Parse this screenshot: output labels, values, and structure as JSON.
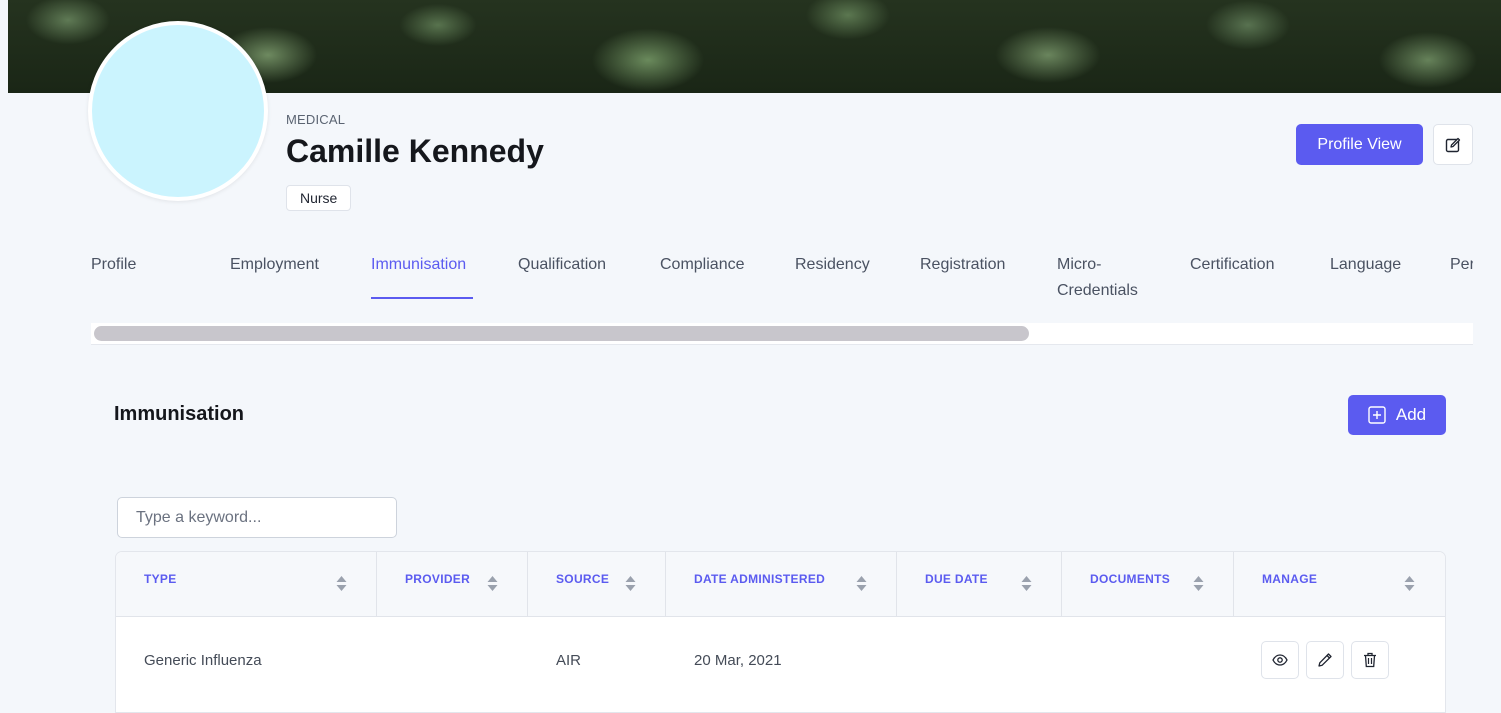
{
  "header": {
    "category": "MEDICAL",
    "name": "Camille Kennedy",
    "role": "Nurse",
    "profile_view_label": "Profile View"
  },
  "tabs": [
    {
      "label": "Profile",
      "active": false
    },
    {
      "label": "Employment",
      "active": false
    },
    {
      "label": "Immunisation",
      "active": true
    },
    {
      "label": "Qualification",
      "active": false
    },
    {
      "label": "Compliance",
      "active": false
    },
    {
      "label": "Residency",
      "active": false
    },
    {
      "label": "Registration",
      "active": false
    },
    {
      "label": "Micro-",
      "label2": "Credentials",
      "active": false
    },
    {
      "label": "Certification",
      "active": false
    },
    {
      "label": "Language",
      "active": false
    },
    {
      "label": "Per",
      "active": false
    }
  ],
  "section": {
    "title": "Immunisation",
    "add_label": "Add",
    "search_placeholder": "Type a keyword..."
  },
  "table": {
    "columns": [
      "TYPE",
      "PROVIDER",
      "SOURCE",
      "DATE ADMINISTERED",
      "DUE DATE",
      "DOCUMENTS",
      "MANAGE"
    ],
    "rows": [
      {
        "type": "Generic Influenza",
        "provider": "",
        "source": "AIR",
        "date_administered": "20 Mar, 2021",
        "due_date": "",
        "documents": ""
      }
    ]
  },
  "colors": {
    "accent": "#5b5bf0",
    "avatar": "#cbf4fe",
    "background": "#f4f7fb"
  }
}
